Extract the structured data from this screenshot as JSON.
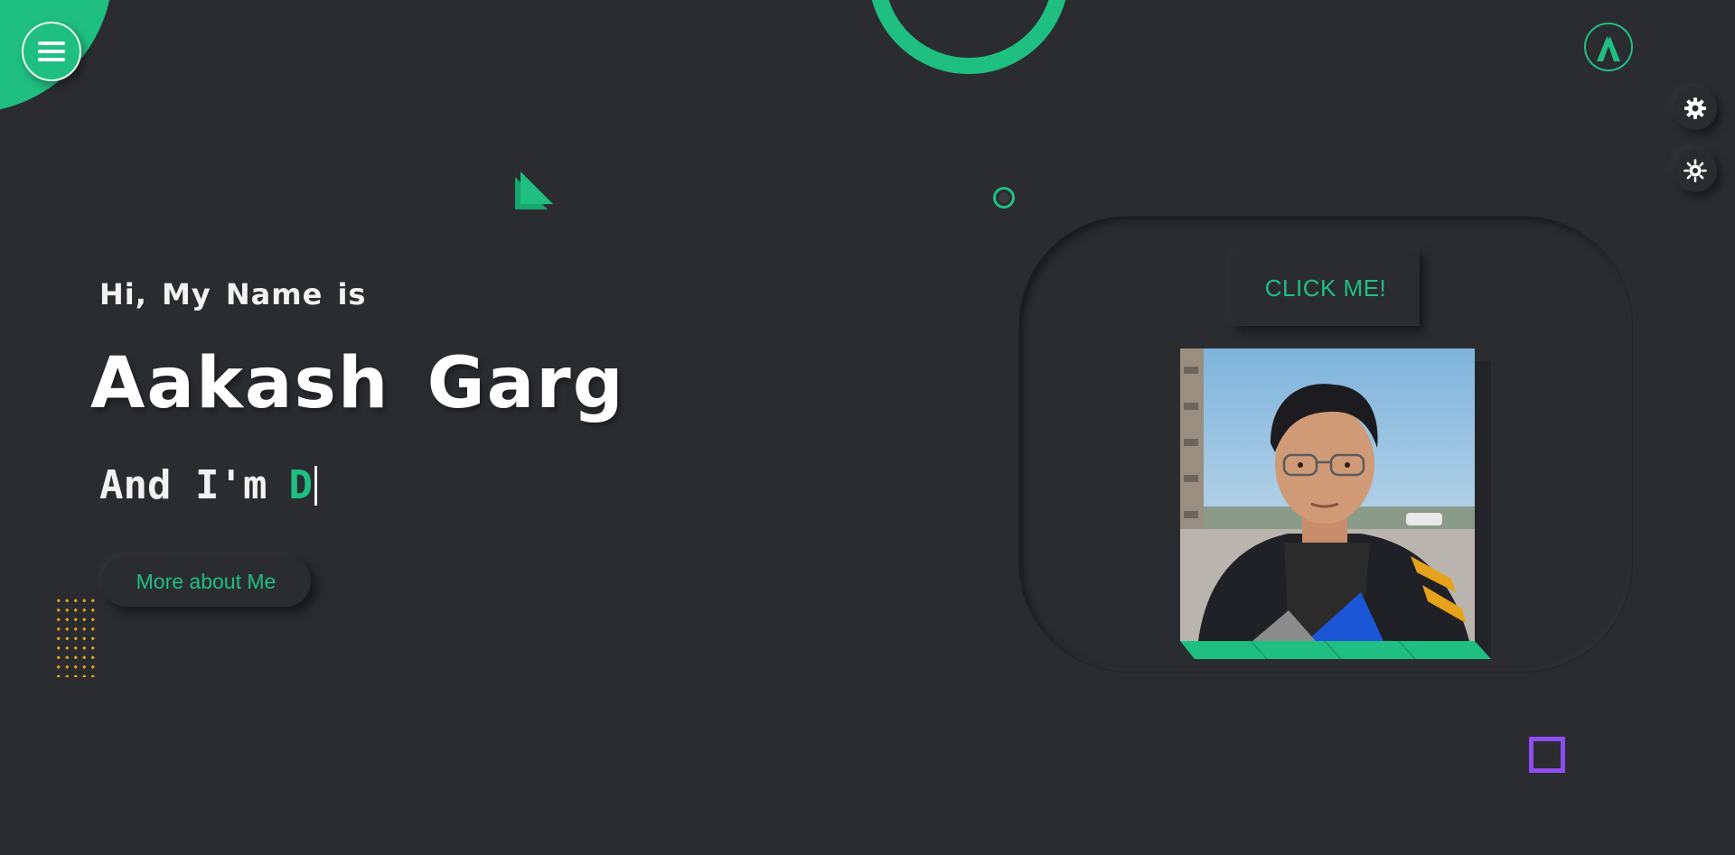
{
  "hero": {
    "intro": "Hi, My Name is",
    "name": "Aakash Garg",
    "role_prefix": "And I'm",
    "role_typed": "D",
    "more_button": "More about Me"
  },
  "card": {
    "click_button": "CLICK ME!"
  },
  "icons": {
    "menu": "hamburger-menu-icon",
    "logo": "logo-a-icon",
    "settings": "gear-icon",
    "theme": "sun-icon"
  },
  "colors": {
    "background": "#2b2c30",
    "accent": "#1fbf82",
    "purple": "#8f4cf0",
    "dots": "#e0a020",
    "text": "#ffffff"
  }
}
